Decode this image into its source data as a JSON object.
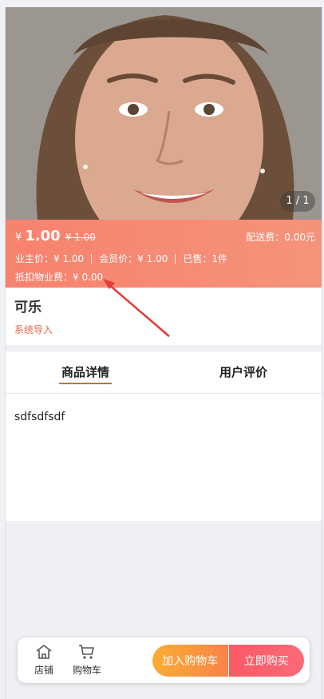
{
  "gallery": {
    "pager": "1 / 1"
  },
  "price_banner": {
    "currency": "¥",
    "price": "1.00",
    "original_price": "¥ 1.00",
    "shipping": "配送费：0.00元",
    "owner_price": "业主价：¥ 1.00",
    "member_price": "会员价：¥ 1.00",
    "sold": "已售：1件",
    "deduct_fee": "抵扣物业费：¥ 0.00"
  },
  "product": {
    "name": "可乐",
    "source": "系统导入"
  },
  "tabs": [
    {
      "label": "商品详情",
      "active": true
    },
    {
      "label": "用户评价",
      "active": false
    }
  ],
  "detail": {
    "text": "sdfsdfsdf"
  },
  "bottom_bar": {
    "shop_label": "店铺",
    "cart_label": "购物车",
    "add_to_cart": "加入购物车",
    "buy_now": "立即购买"
  },
  "colors": {
    "banner": "#f7826e",
    "accent": "#b07a3c",
    "source_text": "#e0654b",
    "add_to_cart": "#fb9a3c",
    "buy_now": "#fa5a66"
  }
}
